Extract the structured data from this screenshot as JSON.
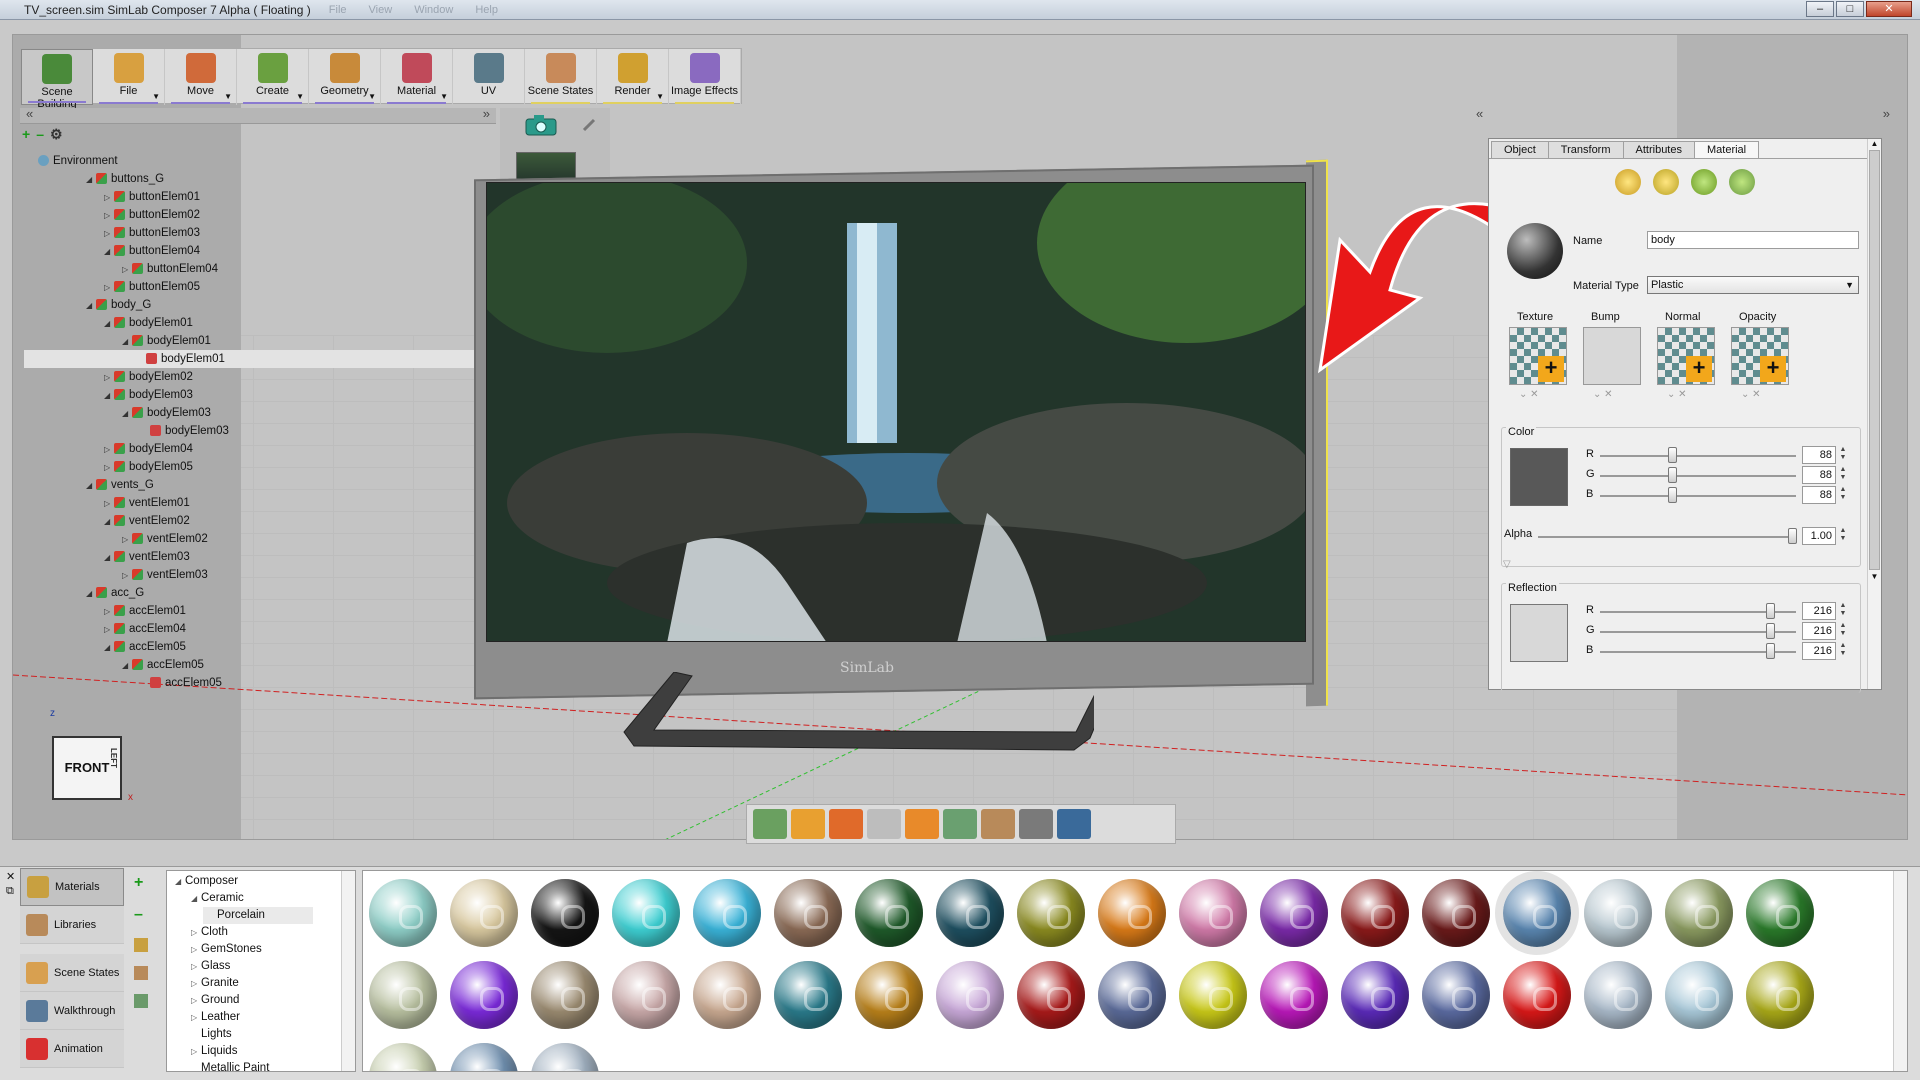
{
  "window": {
    "title": "TV_screen.sim SimLab Composer 7 Alpha ( Floating )",
    "ghost_menu": [
      "File",
      "View",
      "Window",
      "Help"
    ],
    "controls": [
      "–",
      "□",
      "✕"
    ]
  },
  "toolbar": {
    "buttons": [
      {
        "label": "Scene Building",
        "color": "#4a8a3a"
      },
      {
        "label": "File",
        "color": "#d8a040"
      },
      {
        "label": "Move",
        "color": "#d06a3a"
      },
      {
        "label": "Create",
        "color": "#6aa040"
      },
      {
        "label": "Geometry",
        "color": "#c88a3a"
      },
      {
        "label": "Material",
        "color": "#c04a5a"
      },
      {
        "label": "UV",
        "color": "#5a7a8a"
      },
      {
        "label": "Scene States",
        "color": "#c88a5a"
      },
      {
        "label": "Render",
        "color": "#d0a030"
      },
      {
        "label": "Image Effects",
        "color": "#8a6ac0"
      }
    ]
  },
  "scene_tree": {
    "tools": [
      "+",
      "–",
      "⚙"
    ],
    "nodes": [
      {
        "label": "Environment",
        "depth": 0,
        "kind": "env"
      },
      {
        "label": "buttons_G",
        "depth": 1,
        "kind": "group"
      },
      {
        "label": "buttonElem01",
        "depth": 2,
        "kind": "group"
      },
      {
        "label": "buttonElem02",
        "depth": 2,
        "kind": "group"
      },
      {
        "label": "buttonElem03",
        "depth": 2,
        "kind": "group"
      },
      {
        "label": "buttonElem04",
        "depth": 2,
        "kind": "group"
      },
      {
        "label": "buttonElem04",
        "depth": 3,
        "kind": "group"
      },
      {
        "label": "buttonElem05",
        "depth": 2,
        "kind": "group"
      },
      {
        "label": "body_G",
        "depth": 1,
        "kind": "group"
      },
      {
        "label": "bodyElem01",
        "depth": 2,
        "kind": "group"
      },
      {
        "label": "bodyElem01",
        "depth": 3,
        "kind": "group"
      },
      {
        "label": "bodyElem01",
        "depth": 4,
        "kind": "mesh",
        "selected": true
      },
      {
        "label": "bodyElem02",
        "depth": 2,
        "kind": "group"
      },
      {
        "label": "bodyElem03",
        "depth": 2,
        "kind": "group"
      },
      {
        "label": "bodyElem03",
        "depth": 3,
        "kind": "group"
      },
      {
        "label": "bodyElem03",
        "depth": 4,
        "kind": "mesh"
      },
      {
        "label": "bodyElem04",
        "depth": 2,
        "kind": "group"
      },
      {
        "label": "bodyElem05",
        "depth": 2,
        "kind": "group"
      },
      {
        "label": "vents_G",
        "depth": 1,
        "kind": "group"
      },
      {
        "label": "ventElem01",
        "depth": 2,
        "kind": "group"
      },
      {
        "label": "ventElem02",
        "depth": 2,
        "kind": "group"
      },
      {
        "label": "ventElem02",
        "depth": 3,
        "kind": "group"
      },
      {
        "label": "ventElem03",
        "depth": 2,
        "kind": "group"
      },
      {
        "label": "ventElem03",
        "depth": 3,
        "kind": "group"
      },
      {
        "label": "acc_G",
        "depth": 1,
        "kind": "group"
      },
      {
        "label": "accElem01",
        "depth": 2,
        "kind": "group"
      },
      {
        "label": "accElem04",
        "depth": 2,
        "kind": "group"
      },
      {
        "label": "accElem05",
        "depth": 2,
        "kind": "group"
      },
      {
        "label": "accElem05",
        "depth": 3,
        "kind": "group"
      },
      {
        "label": "accElem05",
        "depth": 4,
        "kind": "mesh"
      }
    ]
  },
  "viewport": {
    "brand_text": "SimLab",
    "cube_label": "FRONT",
    "cube_side": "LEFT",
    "axis_z": "z",
    "axis_x": "x"
  },
  "properties": {
    "tabs": [
      "Object",
      "Transform",
      "Attributes",
      "Material"
    ],
    "active_tab": "Material",
    "name_label": "Name",
    "name_value": "body",
    "type_label": "Material Type",
    "type_value": "Plastic",
    "maps": [
      "Texture",
      "Bump",
      "Normal",
      "Opacity"
    ],
    "color_group": {
      "title": "Color",
      "r": "88",
      "g": "88",
      "b": "88",
      "swatch": "#585858",
      "alpha_label": "Alpha",
      "alpha": "1.00"
    },
    "reflection_group": {
      "title": "Reflection",
      "r": "216",
      "g": "216",
      "b": "216",
      "swatch": "#d8d8d8"
    },
    "channel_labels": [
      "R",
      "G",
      "B"
    ]
  },
  "library": {
    "nav": [
      {
        "label": "Materials",
        "active": true
      },
      {
        "label": "Libraries",
        "active": false
      },
      {
        "label": "Scene States",
        "active": false
      },
      {
        "label": "Walkthrough",
        "active": false
      },
      {
        "label": "Animation",
        "active": false
      }
    ],
    "tree": [
      {
        "label": "Composer",
        "depth": 0,
        "arrow": "◢"
      },
      {
        "label": "Ceramic",
        "depth": 1,
        "arrow": "◢"
      },
      {
        "label": "Porcelain",
        "depth": 2,
        "arrow": "",
        "selected": true
      },
      {
        "label": "Cloth",
        "depth": 1,
        "arrow": "▷"
      },
      {
        "label": "GemStones",
        "depth": 1,
        "arrow": "▷"
      },
      {
        "label": "Glass",
        "depth": 1,
        "arrow": "▷"
      },
      {
        "label": "Granite",
        "depth": 1,
        "arrow": "▷"
      },
      {
        "label": "Ground",
        "depth": 1,
        "arrow": "▷"
      },
      {
        "label": "Leather",
        "depth": 1,
        "arrow": "▷"
      },
      {
        "label": "Lights",
        "depth": 1,
        "arrow": ""
      },
      {
        "label": "Liquids",
        "depth": 1,
        "arrow": "▷"
      },
      {
        "label": "Metallic Paint",
        "depth": 1,
        "arrow": ""
      }
    ],
    "swatch_rows": [
      [
        "#8fcfc8",
        "#d9c9a0",
        "#151515",
        "#3ecfd2",
        "#3ab3d8",
        "#8a6a55",
        "#1f5a2a",
        "#1e4f60",
        "#8a8a20",
        "#d87a18",
        "#d07aa8",
        "#7a2aa8",
        "#8a1a1a",
        "#6a1a1a",
        "#5a86b0",
        "#b8c8d0",
        "#8a9a60",
        "#2a7a2a"
      ],
      [
        "#b8c0a0",
        "#7a2ad8",
        "#9a8a70",
        "#c8a8a8",
        "#c8a890",
        "#2a7a8a",
        "#b8801a",
        "#c8a8d8",
        "#a81a1a",
        "#5a6a98",
        "#c8c818",
        "#b818b8",
        "#5a2ab8",
        "#5a6aa0",
        "#d81818",
        "#a8b8c8",
        "#a8c8d8",
        "#a8a818"
      ],
      [
        "#c8d0b0",
        "#7090b0",
        "#a0b0c0"
      ]
    ]
  }
}
